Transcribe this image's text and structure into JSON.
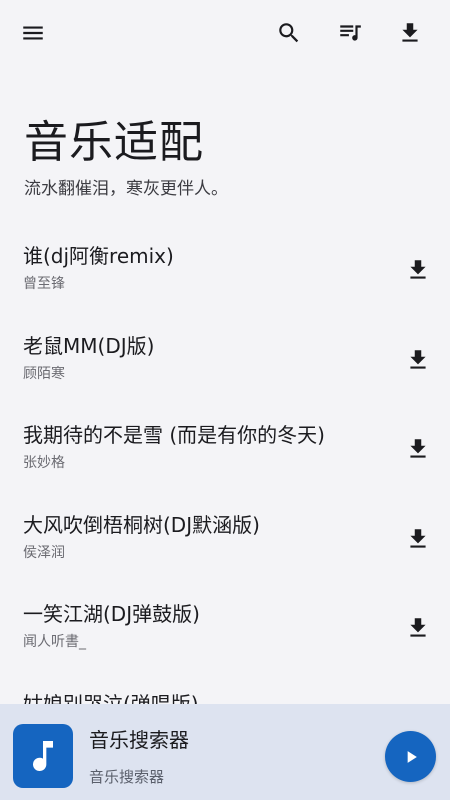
{
  "topbar": {
    "icons": [
      "menu-icon",
      "search-icon",
      "playlist-icon",
      "download-icon"
    ]
  },
  "header": {
    "title": "音乐适配",
    "subtitle": "流水翻催泪，寒灰更伴人。"
  },
  "songs": [
    {
      "title": "谁(dj阿衡remix)",
      "artist": "曾至锋"
    },
    {
      "title": "老鼠MM(DJ版)",
      "artist": "顾陌寒"
    },
    {
      "title": "我期待的不是雪 (而是有你的冬天)",
      "artist": "张妙格"
    },
    {
      "title": "大风吹倒梧桐树(DJ默涵版)",
      "artist": "侯泽润"
    },
    {
      "title": "一笑江湖(DJ弹鼓版)",
      "artist": "闻人听書_"
    },
    {
      "title": "姑娘别哭泣(弹唱版)",
      "artist": ""
    }
  ],
  "player": {
    "title": "音乐搜索器",
    "subtitle": "音乐搜索器",
    "art_icon": "music-note-icon",
    "play_icon": "play-icon"
  },
  "colors": {
    "background": "#f4f4f7",
    "accent": "#1565c0",
    "player_bar": "#dde3f0",
    "text_primary": "#1b1b1f",
    "text_secondary": "#6b6b72"
  }
}
